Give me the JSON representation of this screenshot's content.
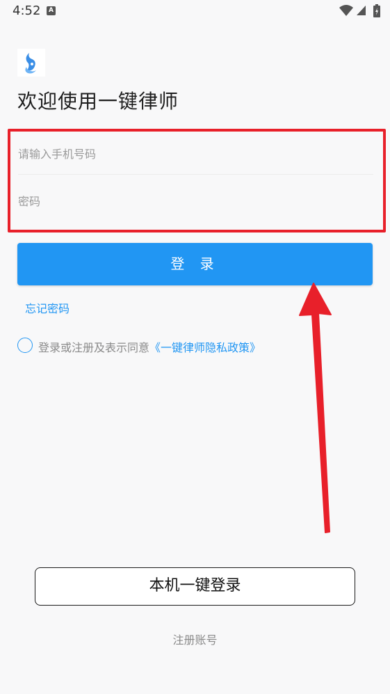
{
  "status_bar": {
    "time": "4:52",
    "notification_icon_letter": "A",
    "icons": [
      "wifi-icon",
      "signal-icon",
      "battery-icon"
    ]
  },
  "header": {
    "logo_icon": "app-logo-icon",
    "title": "欢迎使用一键律师"
  },
  "form": {
    "phone_placeholder": "请输入手机号码",
    "password_placeholder": "密码"
  },
  "actions": {
    "login_label": "登 录",
    "forgot_password": "忘记密码",
    "agree_prefix": "登录或注册及表示同意",
    "privacy_link": "《一键律师隐私政策》",
    "one_click_login": "本机一键登录",
    "register": "注册账号"
  },
  "colors": {
    "accent": "#2196f3",
    "highlight_red": "#e8202a",
    "background": "#f8f8f9"
  }
}
